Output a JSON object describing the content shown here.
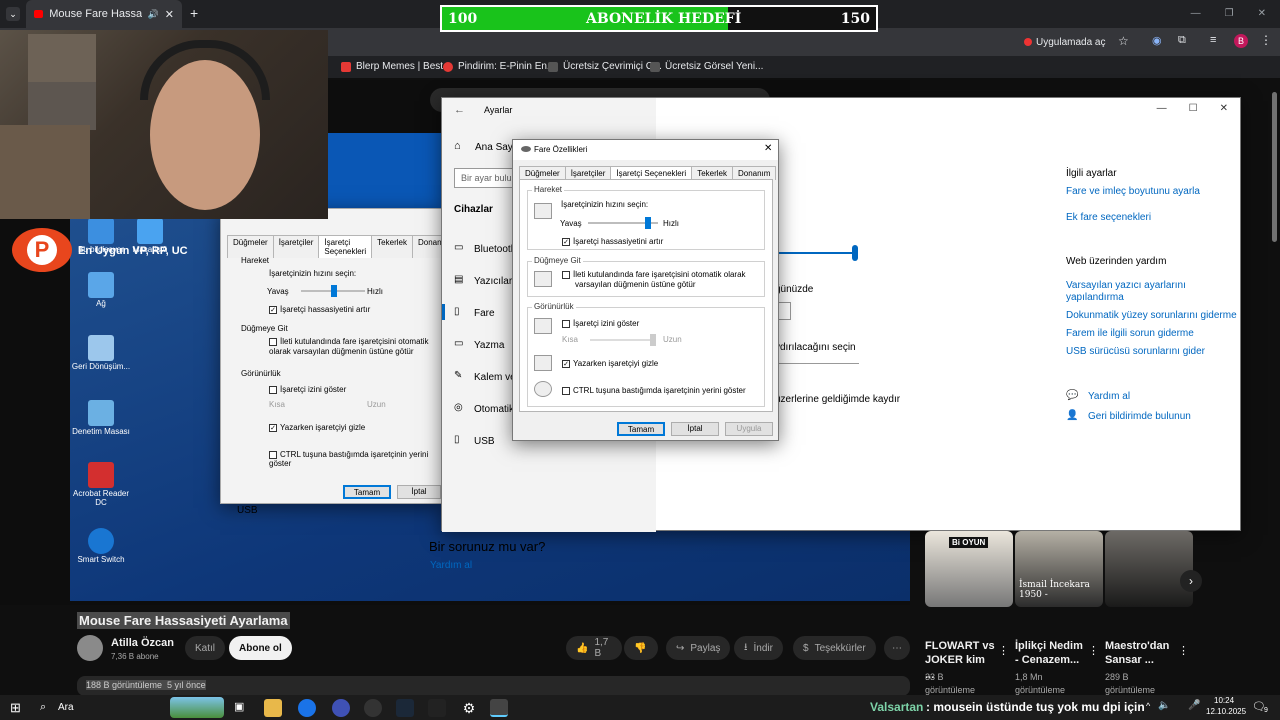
{
  "browser": {
    "tab_title": "Mouse Fare Hassasiyeti Aya",
    "new_tab": "+",
    "open_in_app": "Uygulamada aç",
    "profile": "B",
    "bookmarks": [
      "Blerp Memes | Best...",
      "Pindirim: E-Pinin En...",
      "Ücretsiz Çevrimiçi G...",
      "Ücretsiz Görsel Yeni..."
    ]
  },
  "goal": {
    "start": "100",
    "title": "ABONELİK HEDEFİ",
    "target": "150",
    "progress_fraction": 0.66
  },
  "desktop": {
    "brand_text": "En Uygun VP, RP, UC",
    "icons": [
      "Bu bilgisayar",
      "Masaüstü",
      "Ağ",
      "Geri Dönüşüm...",
      "Denetim Masası",
      "Acrobat Reader DC",
      "Smart Switch"
    ]
  },
  "back_dialog": {
    "tabs": [
      "Düğmeler",
      "İşaretçiler",
      "İşaretçi Seçenekleri",
      "Tekerlek",
      "Donanım"
    ],
    "motion": "Hareket",
    "speed": "İşaretçinizin hızını seçin:",
    "slow": "Yavaş",
    "fast": "Hızlı",
    "precision": "İşaretçi hassasiyetini artır",
    "snap": "Düğmeye Git",
    "snap_text": "İleti kutulandında fare işaretçisini otomatik olarak varsayılan düğmenin üstüne götür",
    "visibility": "Görünürlük",
    "trails": "İşaretçi izini göster",
    "short": "Kısa",
    "long": "Uzun",
    "hide": "Yazarken işaretçiyi gizle",
    "ctrl": "CTRL tuşuna bastığımda işaretçinin yerini göster",
    "ok": "Tamam",
    "cancel": "İptal",
    "usb": "USB"
  },
  "settings": {
    "title": "Ayarlar",
    "home": "Ana Sayfa",
    "search_placeholder": "Bir ayar bulun",
    "section": "Cihazlar",
    "nav": [
      "Bluetooth",
      "Yazıcılar",
      "Fare",
      "Yazma",
      "Kalem ve",
      "Otomatik",
      "USB"
    ],
    "partial_a": "ğünüzde",
    "partial_b": "ydırılacağını seçin",
    "partial_c": "üzerlerine geldiğimde kaydır",
    "related_title": "İlgili ayarlar",
    "related": [
      "Fare ve imleç boyutunu ayarla",
      "Ek fare seçenekleri"
    ],
    "web_title": "Web üzerinden yardım",
    "web_links": [
      "Varsayılan yazıcı ayarlarını yapılandırma",
      "Dokunmatik yüzey sorunlarını giderme",
      "Farem ile ilgili sorun giderme",
      "USB sürücüsü sorunlarını gider"
    ],
    "help": "Yardım al",
    "feedback": "Geri bildirimde bulunun",
    "question": "Bir sorunuz mu var?",
    "question_link": "Yardım al"
  },
  "dialog": {
    "title": "Fare Özellikleri",
    "tabs": [
      "Düğmeler",
      "İşaretçiler",
      "İşaretçi Seçenekleri",
      "Tekerlek",
      "Donanım"
    ],
    "motion": "Hareket",
    "speed": "İşaretçinizin hızını seçin:",
    "slow": "Yavaş",
    "fast": "Hızlı",
    "precision": "İşaretçi hassasiyetini artır",
    "snap": "Düğmeye Git",
    "snap_text1": "İleti kutulandında fare işaretçisini otomatik olarak",
    "snap_text2": "varsayılan düğmenin üstüne götür",
    "visibility": "Görünürlük",
    "trails": "İşaretçi izini göster",
    "short": "Kısa",
    "long": "Uzun",
    "hide": "Yazarken işaretçiyi gizle",
    "ctrl": "CTRL tuşuna bastığımda işaretçinin yerini göster",
    "ok": "Tamam",
    "cancel": "İptal",
    "apply": "Uygula",
    "speed_level": 0.85
  },
  "youtube": {
    "video_title": "Mouse Fare Hassasiyeti Ayarlama",
    "channel": "Atilla Özcan",
    "subs": "7,36 B abone",
    "join": "Katıl",
    "subscribe": "Abone ol",
    "likes": "1,7 B",
    "share": "Paylaş",
    "download": "İndir",
    "thanks": "Teşekkürler",
    "views": "188 B görüntüleme  5 yıl önce",
    "recs": [
      {
        "title": "FLOWART vs JOKER kim ...",
        "meta1": "33 B",
        "meta2": "görüntüleme",
        "thumb_text": "Bi OYUN"
      },
      {
        "title": "İplikçi Nedim - Cenazem...",
        "meta1": "1,8 Mn",
        "meta2": "görüntüleme",
        "thumb_text": "İsmail İncekara 1950 -"
      },
      {
        "title": "Maestro'dan Sansar ...",
        "meta1": "289 B",
        "meta2": "görüntüleme",
        "thumb_text": ""
      }
    ]
  },
  "taskbar": {
    "search": "Ara",
    "ticker_name": "Valsartan",
    "ticker_msg": ": mousein üstünde tuş yok mu dpi için",
    "time": "10:24",
    "date": "12.10.2025",
    "notif": "9"
  }
}
